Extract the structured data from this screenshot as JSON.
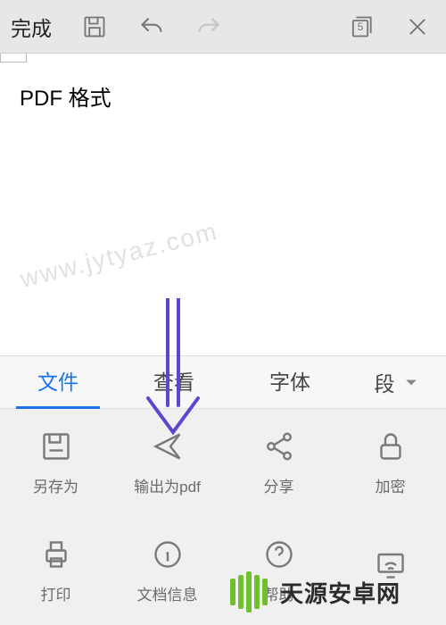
{
  "topbar": {
    "done_label": "完成",
    "save_icon": "save",
    "undo_icon": "undo",
    "redo_icon": "redo",
    "pages_icon": "pages",
    "pages_count": "5",
    "close_icon": "close"
  },
  "document": {
    "text": "PDF 格式"
  },
  "watermark": "www.jytyaz.com",
  "tabs": {
    "items": [
      {
        "label": "文件",
        "active": true
      },
      {
        "label": "查看",
        "active": false
      },
      {
        "label": "字体",
        "active": false
      }
    ],
    "paragraph_label": "段"
  },
  "actions": {
    "row1": [
      {
        "key": "save-as",
        "label": "另存为",
        "icon": "save-as"
      },
      {
        "key": "export-pdf",
        "label": "输出为pdf",
        "icon": "export"
      },
      {
        "key": "share",
        "label": "分享",
        "icon": "share"
      },
      {
        "key": "encrypt",
        "label": "加密",
        "icon": "lock"
      }
    ],
    "row2": [
      {
        "key": "print",
        "label": "打印",
        "icon": "print"
      },
      {
        "key": "doc-info",
        "label": "文档信息",
        "icon": "info"
      },
      {
        "key": "help",
        "label": "帮助",
        "icon": "help"
      },
      {
        "key": "cast",
        "label": "",
        "icon": "cast"
      }
    ]
  },
  "brand": {
    "name": "天源安卓网"
  },
  "colors": {
    "accent": "#1a73e8",
    "brand": "#6fbf2e",
    "icon": "#7a7a7a",
    "topbar_bg": "#e7e7e7",
    "panel_bg": "#f0f0f0",
    "arrow": "#5947d0"
  }
}
